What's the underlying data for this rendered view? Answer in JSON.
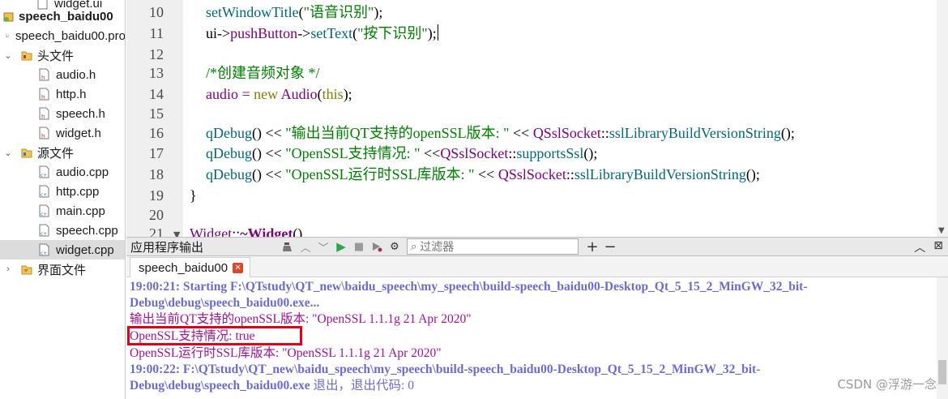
{
  "tree": {
    "items": [
      {
        "label": "widget.ui",
        "kind": "file"
      },
      {
        "label": "speech_baidu00",
        "kind": "project"
      },
      {
        "label": "speech_baidu00.pro",
        "kind": "profile"
      },
      {
        "label": "头文件",
        "kind": "folder"
      },
      {
        "label": "audio.h",
        "kind": "hfile"
      },
      {
        "label": "http.h",
        "kind": "hfile"
      },
      {
        "label": "speech.h",
        "kind": "hfile"
      },
      {
        "label": "widget.h",
        "kind": "hfile"
      },
      {
        "label": "源文件",
        "kind": "folder"
      },
      {
        "label": "audio.cpp",
        "kind": "cppfile"
      },
      {
        "label": "http.cpp",
        "kind": "cppfile"
      },
      {
        "label": "main.cpp",
        "kind": "cppfile"
      },
      {
        "label": "speech.cpp",
        "kind": "cppfile"
      },
      {
        "label": "widget.cpp",
        "kind": "cppfile",
        "selected": true
      },
      {
        "label": "界面文件",
        "kind": "folder"
      }
    ]
  },
  "editor": {
    "line_numbers": [
      "10",
      "11",
      "12",
      "13",
      "14",
      "15",
      "16",
      "17",
      "18",
      "19",
      "20",
      "21"
    ],
    "lines": {
      "l10_fn": "setWindowTitle",
      "l10_rest1": "(",
      "l10_str": "\"语音识别\"",
      "l10_rest2": ");",
      "l11_a": "ui",
      "l11_b": "->",
      "l11_c": "pushButton",
      "l11_d": "->",
      "l11_fn": "setText",
      "l11_e": "(",
      "l11_str": "\"按下识别\"",
      "l11_f": ");",
      "l13_cmt": "/*创建音频对象 */",
      "l14_a": "audio = ",
      "l14_kw": "new",
      "l14_cls": " Audio",
      "l14_b": "(",
      "l14_kw2": "this",
      "l14_c": ");",
      "l16_fn": "qDebug",
      "l16_a": "() << ",
      "l16_str": "\"输出当前QT支持的openSSL版本: \"",
      "l16_b": " << ",
      "l16_cls": "QSslSocket",
      "l16_c": "::",
      "l16_fn2": "sslLibraryBuildVersionString",
      "l16_d": "();",
      "l17_fn": "qDebug",
      "l17_a": "() << ",
      "l17_str": "\"OpenSSL支持情况: \"",
      "l17_b": " <<",
      "l17_cls": "QSslSocket",
      "l17_c": "::",
      "l17_fn2": "supportsSsl",
      "l17_d": "();",
      "l18_fn": "qDebug",
      "l18_a": "() << ",
      "l18_str": "\"OpenSSL运行时SSL库版本: \"",
      "l18_b": " << ",
      "l18_cls": "QSslSocket",
      "l18_c": "::",
      "l18_fn2": "sslLibraryBuildVersionString",
      "l18_d": "();",
      "l19": "}",
      "l21_a": "Widget",
      "l21_b": "::",
      "l21_c": "~Widget",
      "l21_d": "()"
    }
  },
  "output_pane": {
    "title": "应用程序输出",
    "filter_placeholder": "过滤器",
    "tab_label": "speech_baidu00",
    "log": [
      {
        "text": "19:00:21: Starting F:\\QTstudy\\QT_new\\baidu_speech\\my_speech\\build-speech_baidu00-Desktop_Qt_5_15_2_MinGW_32_bit-",
        "kind": "sys"
      },
      {
        "text": "Debug\\debug\\speech_baidu00.exe...",
        "kind": "sys"
      },
      {
        "text": "输出当前QT支持的openSSL版本: \"OpenSSL 1.1.1g  21 Apr 2020\"",
        "kind": "msg"
      },
      {
        "text": "OpenSSL支持情况: true",
        "kind": "msg"
      },
      {
        "text": "OpenSSL运行时SSL库版本: \"OpenSSL 1.1.1g  21 Apr 2020\"",
        "kind": "msg"
      },
      {
        "text": "19:00:22: F:\\QTstudy\\QT_new\\baidu_speech\\my_speech\\build-speech_baidu00-Desktop_Qt_5_15_2_MinGW_32_bit-",
        "kind": "sys"
      },
      {
        "text": "Debug\\debug\\speech_baidu00.exe",
        "kind": "sys",
        "tail": " 退出，退出代码: 0"
      }
    ]
  },
  "watermark": "CSDN @浮游一念",
  "colors": {
    "keyword": "#808000",
    "function": "#00677c",
    "string": "#008000",
    "class": "#800080",
    "log_system": "#6b6bd0",
    "log_message": "#a0129a",
    "highlight_box": "#e0001a"
  }
}
